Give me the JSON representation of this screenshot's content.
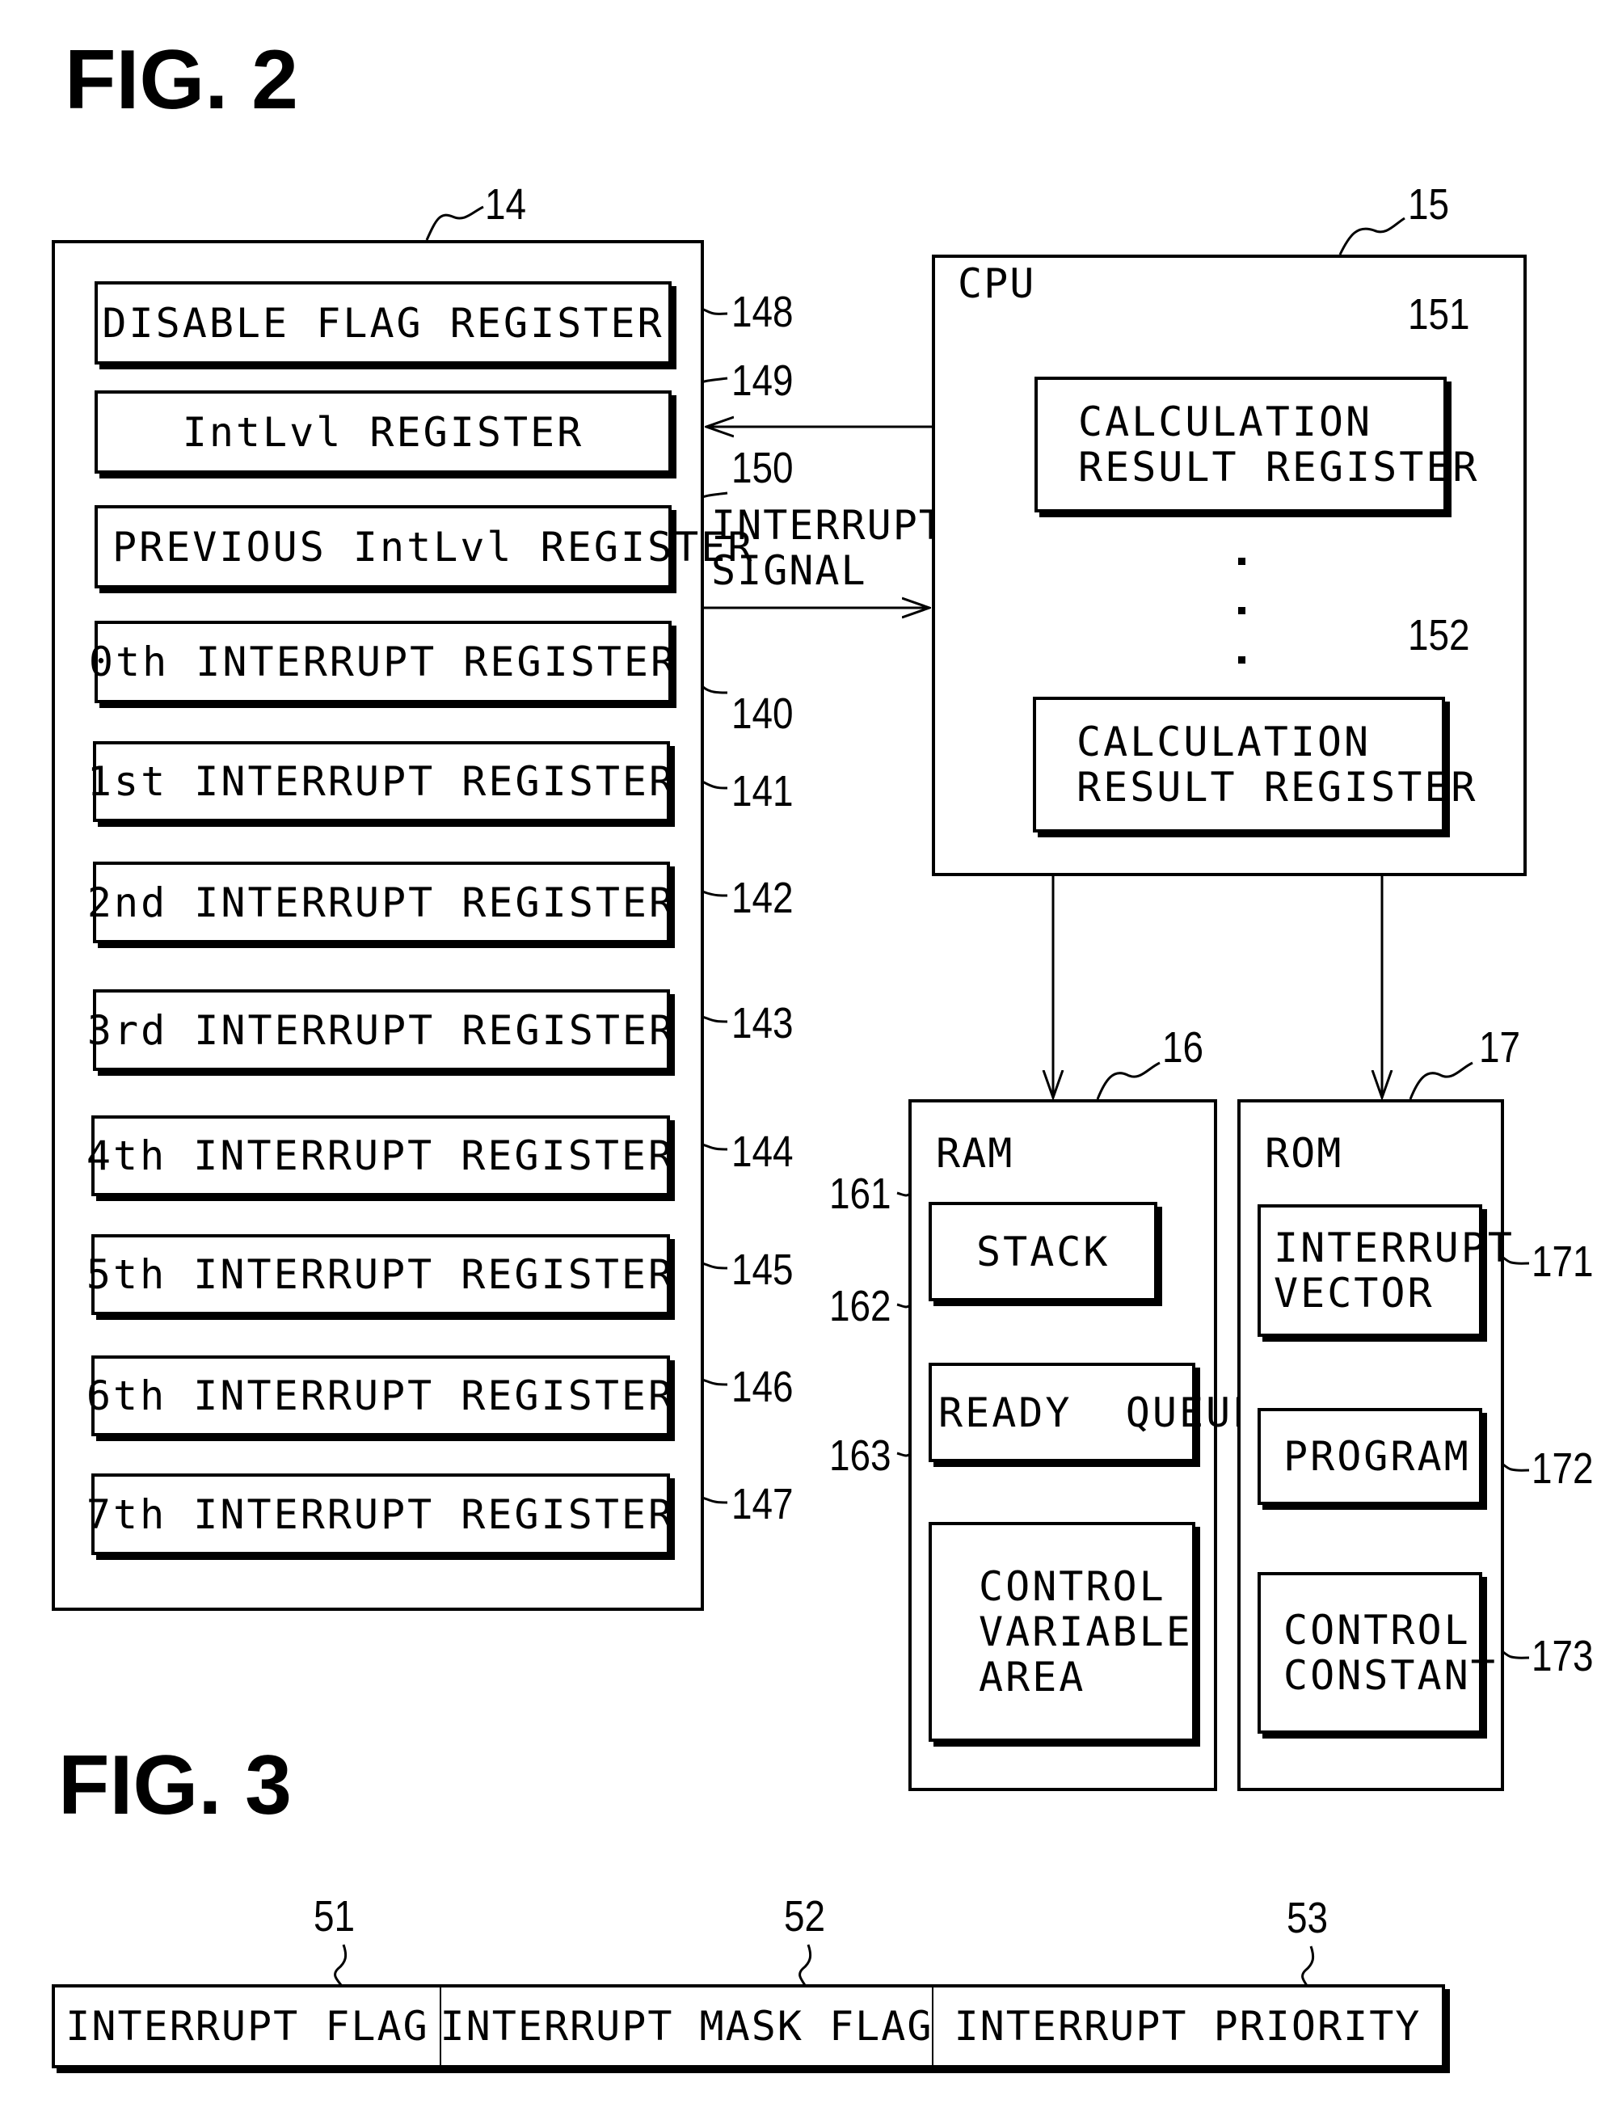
{
  "fig2": {
    "title": "FIG. 2",
    "block14": {
      "ref": "14",
      "registers": [
        {
          "label": "DISABLE FLAG REGISTER",
          "ref": "148"
        },
        {
          "label": "IntLvl REGISTER",
          "ref": "149"
        },
        {
          "label": "PREVIOUS IntLvl REGISTER",
          "ref": "150"
        },
        {
          "label": "0th INTERRUPT REGISTER",
          "ref": "140"
        },
        {
          "label": "1st INTERRUPT REGISTER",
          "ref": "141"
        },
        {
          "label": "2nd INTERRUPT REGISTER",
          "ref": "142"
        },
        {
          "label": "3rd INTERRUPT REGISTER",
          "ref": "143"
        },
        {
          "label": "4th INTERRUPT REGISTER",
          "ref": "144"
        },
        {
          "label": "5th INTERRUPT REGISTER",
          "ref": "145"
        },
        {
          "label": "6th INTERRUPT REGISTER",
          "ref": "146"
        },
        {
          "label": "7th INTERRUPT REGISTER",
          "ref": "147"
        }
      ]
    },
    "signal_label_line1": "INTERRUPT",
    "signal_label_line2": "SIGNAL",
    "cpu": {
      "ref": "15",
      "title": "CPU",
      "registers": [
        {
          "line1": "CALCULATION",
          "line2": "RESULT REGISTER",
          "ref": "151"
        },
        {
          "line1": "CALCULATION",
          "line2": "RESULT REGISTER",
          "ref": "152"
        }
      ],
      "ellipsis": "⋮"
    },
    "ram": {
      "ref": "16",
      "title": "RAM",
      "items": [
        {
          "lines": [
            "STACK"
          ],
          "ref": "161"
        },
        {
          "lines": [
            "READY  QUEUE"
          ],
          "ref": "162"
        },
        {
          "lines": [
            "CONTROL",
            "VARIABLE",
            "AREA"
          ],
          "ref": "163"
        }
      ]
    },
    "rom": {
      "ref": "17",
      "title": "ROM",
      "items": [
        {
          "lines": [
            "INTERRUPT",
            "VECTOR"
          ],
          "ref": "171"
        },
        {
          "lines": [
            "PROGRAM"
          ],
          "ref": "172"
        },
        {
          "lines": [
            "CONTROL",
            "CONSTANT"
          ],
          "ref": "173"
        }
      ]
    }
  },
  "fig3": {
    "title": "FIG. 3",
    "fields": [
      {
        "label": "INTERRUPT FLAG",
        "ref": "51"
      },
      {
        "label": "INTERRUPT MASK FLAG",
        "ref": "52"
      },
      {
        "label": "INTERRUPT PRIORITY",
        "ref": "53"
      }
    ]
  }
}
